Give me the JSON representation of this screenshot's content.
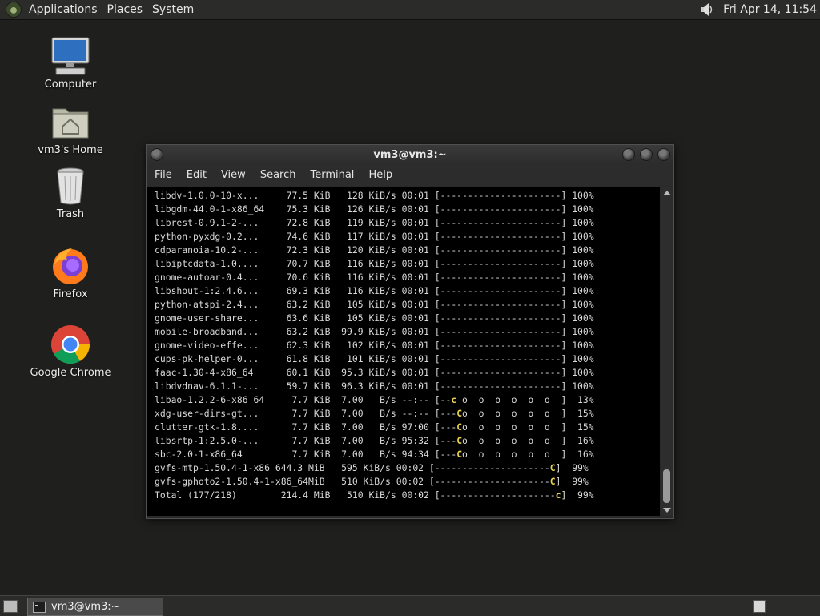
{
  "top_panel": {
    "menus": [
      "Applications",
      "Places",
      "System"
    ],
    "clock": "Fri Apr 14, 11:54"
  },
  "desktop_icons": [
    {
      "label": "Computer",
      "icon": "computer-icon"
    },
    {
      "label": "vm3's Home",
      "icon": "home-folder-icon"
    },
    {
      "label": "Trash",
      "icon": "trash-icon"
    },
    {
      "label": "Firefox",
      "icon": "firefox-icon"
    },
    {
      "label": "Google Chrome",
      "icon": "chrome-icon"
    }
  ],
  "window": {
    "title": "vm3@vm3:~",
    "menu": [
      "File",
      "Edit",
      "View",
      "Search",
      "Terminal",
      "Help"
    ]
  },
  "terminal_lines": [
    {
      "text": "libdv-1.0.0-10-x...     77.5 KiB   128 KiB/s 00:01 [----------------------] 100%"
    },
    {
      "text": "libgdm-44.0-1-x86_64    75.3 KiB   126 KiB/s 00:01 [----------------------] 100%"
    },
    {
      "text": "librest-0.9.1-2-...     72.8 KiB   119 KiB/s 00:01 [----------------------] 100%"
    },
    {
      "text": "python-pyxdg-0.2...     74.6 KiB   117 KiB/s 00:01 [----------------------] 100%"
    },
    {
      "text": "cdparanoia-10.2-...     72.3 KiB   120 KiB/s 00:01 [----------------------] 100%"
    },
    {
      "text": "libiptcdata-1.0....     70.7 KiB   116 KiB/s 00:01 [----------------------] 100%"
    },
    {
      "text": "gnome-autoar-0.4...     70.6 KiB   116 KiB/s 00:01 [----------------------] 100%"
    },
    {
      "text": "libshout-1:2.4.6...     69.3 KiB   116 KiB/s 00:01 [----------------------] 100%"
    },
    {
      "text": "python-atspi-2.4...     63.2 KiB   105 KiB/s 00:01 [----------------------] 100%"
    },
    {
      "text": "gnome-user-share...     63.6 KiB   105 KiB/s 00:01 [----------------------] 100%"
    },
    {
      "text": "mobile-broadband...     63.2 KiB  99.9 KiB/s 00:01 [----------------------] 100%"
    },
    {
      "text": "gnome-video-effe...     62.3 KiB   102 KiB/s 00:01 [----------------------] 100%"
    },
    {
      "text": "cups-pk-helper-0...     61.8 KiB   101 KiB/s 00:01 [----------------------] 100%"
    },
    {
      "text": "faac-1.30-4-x86_64      60.1 KiB  95.3 KiB/s 00:01 [----------------------] 100%"
    },
    {
      "text": "libdvdnav-6.1.1-...     59.7 KiB  96.3 KiB/s 00:01 [----------------------] 100%"
    },
    {
      "text": "libao-1.2.2-6-x86_64     7.7 KiB  7.00   B/s --:-- [--",
      "hl": "c",
      "tail": " o  o  o  o  o  o  ]  13%"
    },
    {
      "text": "xdg-user-dirs-gt...      7.7 KiB  7.00   B/s --:-- [---",
      "hl": "C",
      "tail": "o  o  o  o  o  o  ]  15%"
    },
    {
      "text": "clutter-gtk-1.8....      7.7 KiB  7.00   B/s 97:00 [---",
      "hl": "C",
      "tail": "o  o  o  o  o  o  ]  15%"
    },
    {
      "text": "libsrtp-1:2.5.0-...      7.7 KiB  7.00   B/s 95:32 [---",
      "hl": "C",
      "tail": "o  o  o  o  o  o  ]  16%"
    },
    {
      "text": "sbc-2.0-1-x86_64         7.7 KiB  7.00   B/s 94:34 [---",
      "hl": "C",
      "tail": "o  o  o  o  o  o  ]  16%"
    },
    {
      "text": "gvfs-mtp-1.50.4-1-x86_644.3 MiB   595 KiB/s 00:02 [---------------------",
      "hl": "C",
      "tail": "]  99%"
    },
    {
      "text": "gvfs-gphoto2-1.50.4-1-x86_64MiB   510 KiB/s 00:02 [---------------------",
      "hl": "C",
      "tail": "]  99%"
    },
    {
      "text": "Total (177/218)        214.4 MiB   510 KiB/s 00:02 [---------------------",
      "hl": "c",
      "tail": "]  99%"
    }
  ],
  "taskbar": {
    "window_button": "vm3@vm3:~"
  },
  "colors": {
    "desktop_bg": "#1f201e",
    "panel_bg": "#2b2c2a",
    "terminal_bg": "#000000",
    "terminal_fg": "#d9d9d9",
    "pacman_yellow": "#e8d44d"
  }
}
